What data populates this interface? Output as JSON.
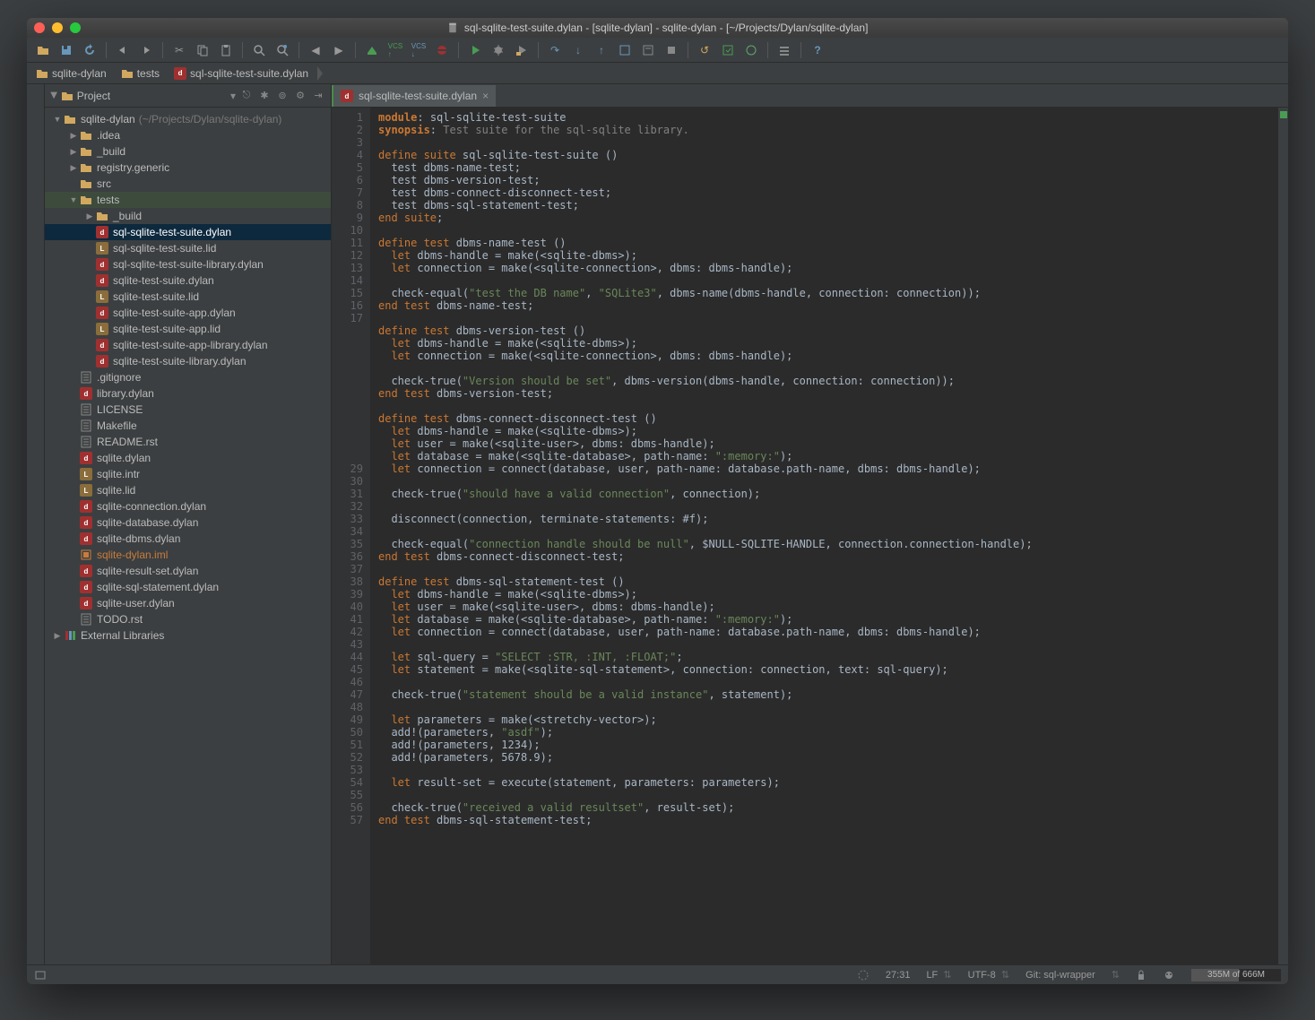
{
  "title": "sql-sqlite-test-suite.dylan - [sqlite-dylan] - sqlite-dylan - [~/Projects/Dylan/sqlite-dylan]",
  "breadcrumbs": [
    "sqlite-dylan",
    "tests",
    "sql-sqlite-test-suite.dylan"
  ],
  "project_panel": {
    "label": "Project",
    "root": "sqlite-dylan",
    "root_hint": "(~/Projects/Dylan/sqlite-dylan)"
  },
  "tree": [
    {
      "d": 0,
      "arrow": "▼",
      "icon": "folder",
      "label": "sqlite-dylan",
      "hint": "(~/Projects/Dylan/sqlite-dylan)"
    },
    {
      "d": 1,
      "arrow": "▶",
      "icon": "folder",
      "label": ".idea"
    },
    {
      "d": 1,
      "arrow": "▶",
      "icon": "folder",
      "label": "_build"
    },
    {
      "d": 1,
      "arrow": "▶",
      "icon": "folder",
      "label": "registry.generic"
    },
    {
      "d": 1,
      "arrow": "",
      "icon": "folder",
      "label": "src"
    },
    {
      "d": 1,
      "arrow": "▼",
      "icon": "folder",
      "label": "tests",
      "hl": "folder"
    },
    {
      "d": 2,
      "arrow": "▶",
      "icon": "folder",
      "label": "_build"
    },
    {
      "d": 2,
      "arrow": "",
      "icon": "dylan",
      "label": "sql-sqlite-test-suite.dylan",
      "hl": "selected"
    },
    {
      "d": 2,
      "arrow": "",
      "icon": "lid",
      "label": "sql-sqlite-test-suite.lid"
    },
    {
      "d": 2,
      "arrow": "",
      "icon": "dylan",
      "label": "sql-sqlite-test-suite-library.dylan"
    },
    {
      "d": 2,
      "arrow": "",
      "icon": "dylan",
      "label": "sqlite-test-suite.dylan"
    },
    {
      "d": 2,
      "arrow": "",
      "icon": "lid",
      "label": "sqlite-test-suite.lid"
    },
    {
      "d": 2,
      "arrow": "",
      "icon": "dylan",
      "label": "sqlite-test-suite-app.dylan"
    },
    {
      "d": 2,
      "arrow": "",
      "icon": "lid",
      "label": "sqlite-test-suite-app.lid"
    },
    {
      "d": 2,
      "arrow": "",
      "icon": "dylan",
      "label": "sqlite-test-suite-app-library.dylan"
    },
    {
      "d": 2,
      "arrow": "",
      "icon": "dylan",
      "label": "sqlite-test-suite-library.dylan"
    },
    {
      "d": 1,
      "arrow": "",
      "icon": "text",
      "label": ".gitignore"
    },
    {
      "d": 1,
      "arrow": "",
      "icon": "dylan",
      "label": "library.dylan"
    },
    {
      "d": 1,
      "arrow": "",
      "icon": "text",
      "label": "LICENSE"
    },
    {
      "d": 1,
      "arrow": "",
      "icon": "text",
      "label": "Makefile"
    },
    {
      "d": 1,
      "arrow": "",
      "icon": "text",
      "label": "README.rst"
    },
    {
      "d": 1,
      "arrow": "",
      "icon": "dylan",
      "label": "sqlite.dylan"
    },
    {
      "d": 1,
      "arrow": "",
      "icon": "lid",
      "label": "sqlite.intr"
    },
    {
      "d": 1,
      "arrow": "",
      "icon": "lid",
      "label": "sqlite.lid"
    },
    {
      "d": 1,
      "arrow": "",
      "icon": "dylan",
      "label": "sqlite-connection.dylan"
    },
    {
      "d": 1,
      "arrow": "",
      "icon": "dylan",
      "label": "sqlite-database.dylan"
    },
    {
      "d": 1,
      "arrow": "",
      "icon": "dylan",
      "label": "sqlite-dbms.dylan"
    },
    {
      "d": 1,
      "arrow": "",
      "icon": "iml",
      "label": "sqlite-dylan.iml",
      "color": "#c87c3c"
    },
    {
      "d": 1,
      "arrow": "",
      "icon": "dylan",
      "label": "sqlite-result-set.dylan"
    },
    {
      "d": 1,
      "arrow": "",
      "icon": "dylan",
      "label": "sqlite-sql-statement.dylan"
    },
    {
      "d": 1,
      "arrow": "",
      "icon": "dylan",
      "label": "sqlite-user.dylan"
    },
    {
      "d": 1,
      "arrow": "",
      "icon": "text",
      "label": "TODO.rst"
    },
    {
      "d": 0,
      "arrow": "▶",
      "icon": "lib",
      "label": "External Libraries"
    }
  ],
  "editor_tab": "sql-sqlite-test-suite.dylan",
  "gutter": [
    "1",
    "2",
    "3",
    "4",
    "5",
    "6",
    "7",
    "8",
    "9",
    "10",
    "11",
    "12",
    "13",
    "14",
    "15",
    "16",
    "17",
    "",
    "",
    "",
    "",
    "",
    "",
    "",
    "",
    "",
    "",
    "",
    "29",
    "30",
    "31",
    "32",
    "33",
    "34",
    "35",
    "36",
    "37",
    "38",
    "39",
    "40",
    "41",
    "42",
    "43",
    "44",
    "45",
    "46",
    "47",
    "48",
    "49",
    "50",
    "51",
    "52",
    "53",
    "54",
    "55",
    "56",
    "57"
  ],
  "code_lines": [
    [
      [
        "kw",
        "module"
      ],
      [
        "",
        ":"
      ],
      [
        "",
        " sql-sqlite-test-suite"
      ]
    ],
    [
      [
        "kw",
        "synopsis"
      ],
      [
        "",
        ":"
      ],
      [
        "comment",
        " Test suite for the sql-sqlite library."
      ]
    ],
    [
      [
        "",
        ""
      ]
    ],
    [
      [
        "kw2",
        "define suite"
      ],
      [
        "",
        " sql-sqlite-test-suite ()"
      ]
    ],
    [
      [
        "",
        "  test dbms-name-test;"
      ]
    ],
    [
      [
        "",
        "  test dbms-version-test;"
      ]
    ],
    [
      [
        "",
        "  test dbms-connect-disconnect-test;"
      ]
    ],
    [
      [
        "",
        "  test dbms-sql-statement-test;"
      ]
    ],
    [
      [
        "kw2",
        "end suite"
      ],
      [
        "",
        ";"
      ]
    ],
    [
      [
        "",
        ""
      ]
    ],
    [
      [
        "kw2",
        "define test"
      ],
      [
        "",
        " dbms-name-test ()"
      ]
    ],
    [
      [
        "",
        "  "
      ],
      [
        "kw2",
        "let"
      ],
      [
        "",
        " dbms-handle = make(<sqlite-dbms>);"
      ]
    ],
    [
      [
        "",
        "  "
      ],
      [
        "kw2",
        "let"
      ],
      [
        "",
        " connection = make(<sqlite-connection>, dbms: dbms-handle);"
      ]
    ],
    [
      [
        "",
        ""
      ]
    ],
    [
      [
        "",
        "  check-equal("
      ],
      [
        "str",
        "\"test the DB name\""
      ],
      [
        "",
        ", "
      ],
      [
        "str",
        "\"SQLite3\""
      ],
      [
        "",
        ", dbms-name(dbms-handle, connection: connection));"
      ]
    ],
    [
      [
        "kw2",
        "end test"
      ],
      [
        "",
        " dbms-name-test;"
      ]
    ],
    [
      [
        "",
        ""
      ]
    ],
    [
      [
        "kw2",
        "define test"
      ],
      [
        "",
        " dbms-version-test ()"
      ]
    ],
    [
      [
        "",
        "  "
      ],
      [
        "kw2",
        "let"
      ],
      [
        "",
        " dbms-handle = make(<sqlite-dbms>);"
      ]
    ],
    [
      [
        "",
        "  "
      ],
      [
        "kw2",
        "let"
      ],
      [
        "",
        " connection = make(<sqlite-connection>, dbms: dbms-handle);"
      ]
    ],
    [
      [
        "",
        ""
      ]
    ],
    [
      [
        "",
        "  check-true("
      ],
      [
        "str",
        "\"Version should be set\""
      ],
      [
        "",
        ", dbms-version(dbms-handle, connection: connection));"
      ]
    ],
    [
      [
        "kw2",
        "end test"
      ],
      [
        "",
        " dbms-version-test;"
      ]
    ],
    [
      [
        "",
        ""
      ]
    ],
    [
      [
        "kw2",
        "define test"
      ],
      [
        "",
        " dbms-connect-disconnect-test ()"
      ]
    ],
    [
      [
        "",
        "  "
      ],
      [
        "kw2",
        "let"
      ],
      [
        "",
        " dbms-handle = make(<sqlite-dbms>);"
      ]
    ],
    [
      [
        "",
        "  "
      ],
      [
        "kw2",
        "let"
      ],
      [
        "",
        " user = make(<sqlite-user>, dbms: dbms-handle);"
      ]
    ],
    [
      [
        "",
        "  "
      ],
      [
        "kw2",
        "let"
      ],
      [
        "",
        " database = make(<sqlite-database>, path-name: "
      ],
      [
        "str",
        "\":memory:\""
      ],
      [
        "",
        ");"
      ]
    ],
    [
      [
        "",
        "  "
      ],
      [
        "kw2",
        "let"
      ],
      [
        "",
        " connection = connect(database, user, path-name: database.path-name, dbms: dbms-handle);"
      ]
    ],
    [
      [
        "",
        ""
      ]
    ],
    [
      [
        "",
        "  check-true("
      ],
      [
        "str",
        "\"should have a valid connection\""
      ],
      [
        "",
        ", connection);"
      ]
    ],
    [
      [
        "",
        ""
      ]
    ],
    [
      [
        "",
        "  disconnect(connection, terminate-statements: #f);"
      ]
    ],
    [
      [
        "",
        ""
      ]
    ],
    [
      [
        "",
        "  check-equal("
      ],
      [
        "str",
        "\"connection handle should be null\""
      ],
      [
        "",
        ", $NULL-SQLITE-HANDLE, connection.connection-handle);"
      ]
    ],
    [
      [
        "kw2",
        "end test"
      ],
      [
        "",
        " dbms-connect-disconnect-test;"
      ]
    ],
    [
      [
        "",
        ""
      ]
    ],
    [
      [
        "kw2",
        "define test"
      ],
      [
        "",
        " dbms-sql-statement-test ()"
      ]
    ],
    [
      [
        "",
        "  "
      ],
      [
        "kw2",
        "let"
      ],
      [
        "",
        " dbms-handle = make(<sqlite-dbms>);"
      ]
    ],
    [
      [
        "",
        "  "
      ],
      [
        "kw2",
        "let"
      ],
      [
        "",
        " user = make(<sqlite-user>, dbms: dbms-handle);"
      ]
    ],
    [
      [
        "",
        "  "
      ],
      [
        "kw2",
        "let"
      ],
      [
        "",
        " database = make(<sqlite-database>, path-name: "
      ],
      [
        "str",
        "\":memory:\""
      ],
      [
        "",
        ");"
      ]
    ],
    [
      [
        "",
        "  "
      ],
      [
        "kw2",
        "let"
      ],
      [
        "",
        " connection = connect(database, user, path-name: database.path-name, dbms: dbms-handle);"
      ]
    ],
    [
      [
        "",
        ""
      ]
    ],
    [
      [
        "",
        "  "
      ],
      [
        "kw2",
        "let"
      ],
      [
        "",
        " sql-query = "
      ],
      [
        "str",
        "\"SELECT :STR, :INT, :FLOAT;\""
      ],
      [
        "",
        ";"
      ]
    ],
    [
      [
        "",
        "  "
      ],
      [
        "kw2",
        "let"
      ],
      [
        "",
        " statement = make(<sqlite-sql-statement>, connection: connection, text: sql-query);"
      ]
    ],
    [
      [
        "",
        ""
      ]
    ],
    [
      [
        "",
        "  check-true("
      ],
      [
        "str",
        "\"statement should be a valid instance\""
      ],
      [
        "",
        ", statement);"
      ]
    ],
    [
      [
        "",
        ""
      ]
    ],
    [
      [
        "",
        "  "
      ],
      [
        "kw2",
        "let"
      ],
      [
        "",
        " parameters = make(<stretchy-vector>);"
      ]
    ],
    [
      [
        "",
        "  add!(parameters, "
      ],
      [
        "str",
        "\"asdf\""
      ],
      [
        "",
        ");"
      ]
    ],
    [
      [
        "",
        "  add!(parameters, 1234);"
      ]
    ],
    [
      [
        "",
        "  add!(parameters, 5678.9);"
      ]
    ],
    [
      [
        "",
        ""
      ]
    ],
    [
      [
        "",
        "  "
      ],
      [
        "kw2",
        "let"
      ],
      [
        "",
        " result-set = execute(statement, parameters: parameters);"
      ]
    ],
    [
      [
        "",
        ""
      ]
    ],
    [
      [
        "",
        "  check-true("
      ],
      [
        "str",
        "\"received a valid resultset\""
      ],
      [
        "",
        ", result-set);"
      ]
    ],
    [
      [
        "kw2",
        "end test"
      ],
      [
        "",
        " dbms-sql-statement-test;"
      ]
    ]
  ],
  "statusbar": {
    "cursor": "27:31",
    "line_sep": "LF",
    "encoding": "UTF-8",
    "git": "Git: sql-wrapper",
    "memory": "355M of 666M"
  }
}
